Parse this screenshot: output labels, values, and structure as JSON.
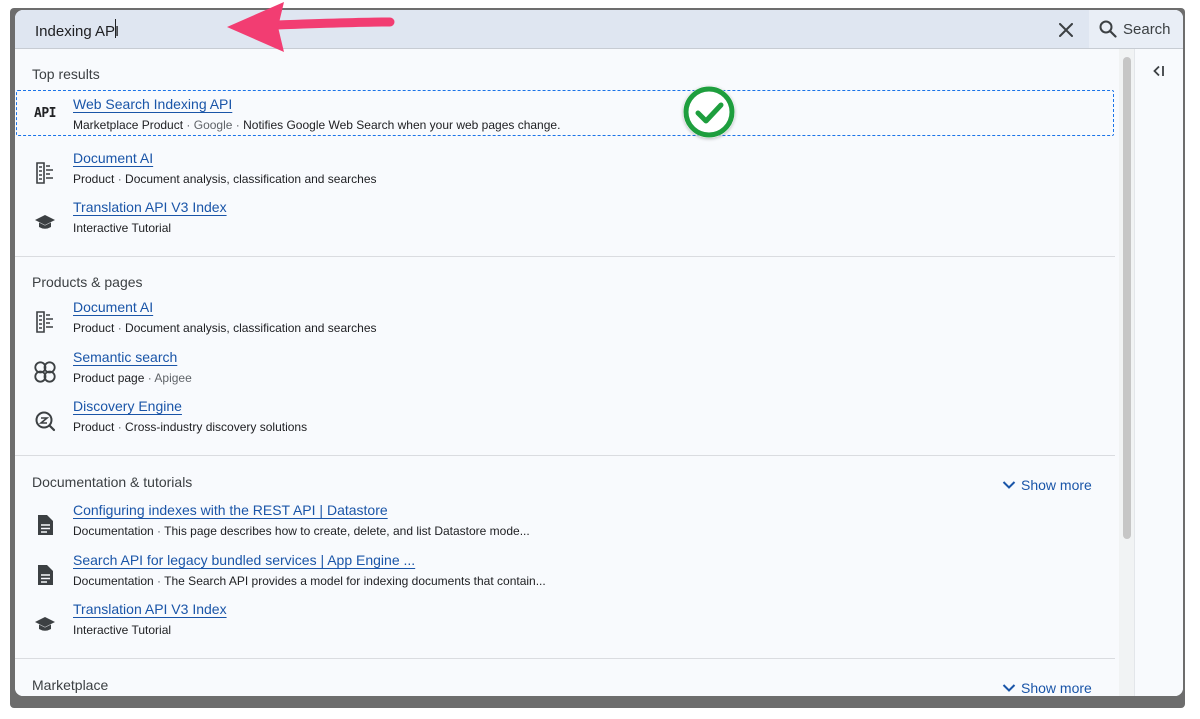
{
  "search": {
    "value": "Indexing API",
    "button_label": "Search"
  },
  "sections": {
    "top_results": {
      "title": "Top results",
      "items": [
        {
          "icon": "api-icon",
          "title": "Web Search Indexing API",
          "type": "Marketplace Product",
          "meta": "Google",
          "desc": "Notifies Google Web Search when your web pages change."
        },
        {
          "icon": "document-ai-icon",
          "title": "Document AI",
          "type": "Product",
          "desc": "Document analysis, classification and searches"
        },
        {
          "icon": "graduation-cap-icon",
          "title": "Translation API V3 Index",
          "type": "Interactive Tutorial"
        }
      ]
    },
    "products_pages": {
      "title": "Products & pages",
      "items": [
        {
          "icon": "document-ai-icon",
          "title": "Document AI",
          "type": "Product",
          "desc": "Document analysis, classification and searches"
        },
        {
          "icon": "apigee-icon",
          "title": "Semantic search",
          "type": "Product page",
          "desc": "Apigee"
        },
        {
          "icon": "discovery-engine-icon",
          "title": "Discovery Engine",
          "type": "Product",
          "desc": "Cross-industry discovery solutions"
        }
      ]
    },
    "docs_tutorials": {
      "title": "Documentation & tutorials",
      "show_more": "Show more",
      "items": [
        {
          "icon": "document-icon",
          "title": "Configuring indexes with the REST API | Datastore",
          "type": "Documentation",
          "desc": "This page describes how to create, delete, and list Datastore mode..."
        },
        {
          "icon": "document-icon",
          "title": "Search API for legacy bundled services | App Engine ...",
          "type": "Documentation",
          "desc": "The Search API provides a model for indexing documents that contain..."
        },
        {
          "icon": "graduation-cap-icon",
          "title": "Translation API V3 Index",
          "type": "Interactive Tutorial"
        }
      ]
    },
    "marketplace": {
      "title": "Marketplace",
      "show_more": "Show more"
    }
  },
  "api_badge_text": "API",
  "separator": " · ",
  "colors": {
    "link": "#1a55a8",
    "annotation_arrow": "#f23d72",
    "check_green": "#1e9e3e",
    "selection_outline": "#1a73e8"
  }
}
